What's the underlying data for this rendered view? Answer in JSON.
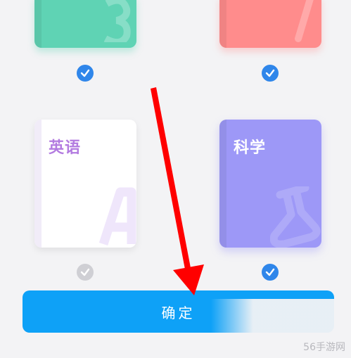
{
  "books": [
    {
      "id": "top-left",
      "label": "",
      "color": "#5fd3b4",
      "checked": true
    },
    {
      "id": "top-right",
      "label": "",
      "color": "#ff8c8c",
      "checked": true
    },
    {
      "id": "english",
      "label": "英语",
      "color": "#ffffff",
      "checked": false
    },
    {
      "id": "science",
      "label": "科学",
      "color": "#9d98f7",
      "checked": true
    }
  ],
  "confirm": {
    "label": "确定",
    "color": "#0ea1f7"
  },
  "annotation": {
    "arrow_color": "#ff0000"
  },
  "watermark": "56手游网",
  "icons": {
    "check": "check-icon"
  }
}
